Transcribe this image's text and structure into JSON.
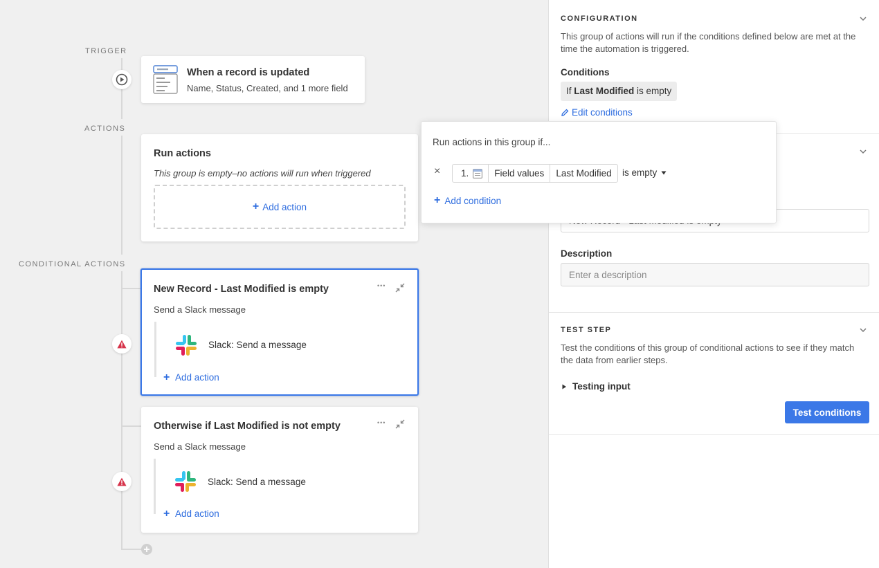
{
  "canvas": {
    "labels": {
      "trigger": "TRIGGER",
      "actions": "ACTIONS",
      "conditional_actions": "CONDITIONAL ACTIONS"
    },
    "trigger_card": {
      "title": "When a record is updated",
      "subtitle": "Name, Status, Created, and 1 more field",
      "icon": "table-form-icon"
    },
    "run_actions_card": {
      "title": "Run actions",
      "empty_text": "This group is empty–no actions will run when triggered",
      "add_action": "Add action"
    },
    "conditional_groups": [
      {
        "title": "New Record - Last Modified is empty",
        "subtitle": "Send a Slack message",
        "action_label": "Slack: Send a message",
        "add_action": "Add action",
        "warning": true,
        "selected": true
      },
      {
        "title": "Otherwise if Last Modified is not empty",
        "subtitle": "Send a Slack message",
        "action_label": "Slack: Send a message",
        "add_action": "Add action",
        "warning": true,
        "selected": false
      }
    ],
    "menu_glyph": "•••"
  },
  "popover": {
    "heading": "Run actions in this group if...",
    "condition": {
      "remove_glyph": "×",
      "step": "1.",
      "source": "Field values",
      "field": "Last Modified",
      "operator": "is empty"
    },
    "add_condition": "Add condition"
  },
  "panel": {
    "configuration": {
      "heading": "CONFIGURATION",
      "description": "This group of actions will run if the conditions defined below are met at the time the automation is triggered.",
      "conditions_label": "Conditions",
      "condition_summary_prefix": "If",
      "condition_summary_field": "Last Modified",
      "condition_summary_suffix": "is empty",
      "edit_conditions": "Edit conditions"
    },
    "details": {
      "name_value": "New Record - Last Modified is empty",
      "description_label": "Description",
      "description_placeholder": "Enter a description"
    },
    "test_step": {
      "heading": "TEST STEP",
      "description": "Test the conditions of this group of conditional actions to see if they match the data from earlier steps.",
      "testing_input": "Testing input",
      "button": "Test conditions"
    }
  },
  "colors": {
    "accent": "#3b78e7",
    "link": "#2d6cdf",
    "warning": "#d6334a"
  }
}
